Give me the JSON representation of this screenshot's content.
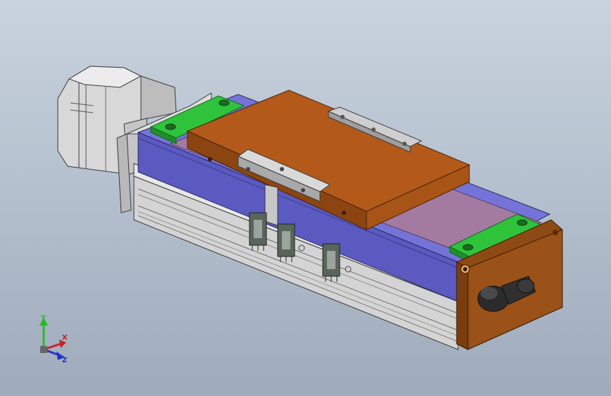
{
  "viewport": {
    "background_top": "#c9d3df",
    "background_bottom": "#9fabbb"
  },
  "model": {
    "colors": {
      "carriage_top": "#b55a1a",
      "carriage_side": "#9a4a12",
      "rail_blue": "#6a6ad2",
      "rail_blue_dark": "#4b4ba6",
      "belt_cover": "#a87898",
      "green_plate": "#2ec33a",
      "aluminium": "#cfcfcf",
      "end_cap": "#8c4a14",
      "sensor": "#59665c"
    },
    "parts": [
      "stepper-motor",
      "motor-flange",
      "base-profile",
      "blue-rail",
      "carriage-table",
      "end-cap",
      "cable-connector",
      "limit-sensors"
    ]
  },
  "triad": {
    "y_label": "Y",
    "x_label": "X",
    "z_label": "Z",
    "y_color": "#2eb82e",
    "x_color": "#cc2222",
    "z_color": "#2233cc"
  }
}
